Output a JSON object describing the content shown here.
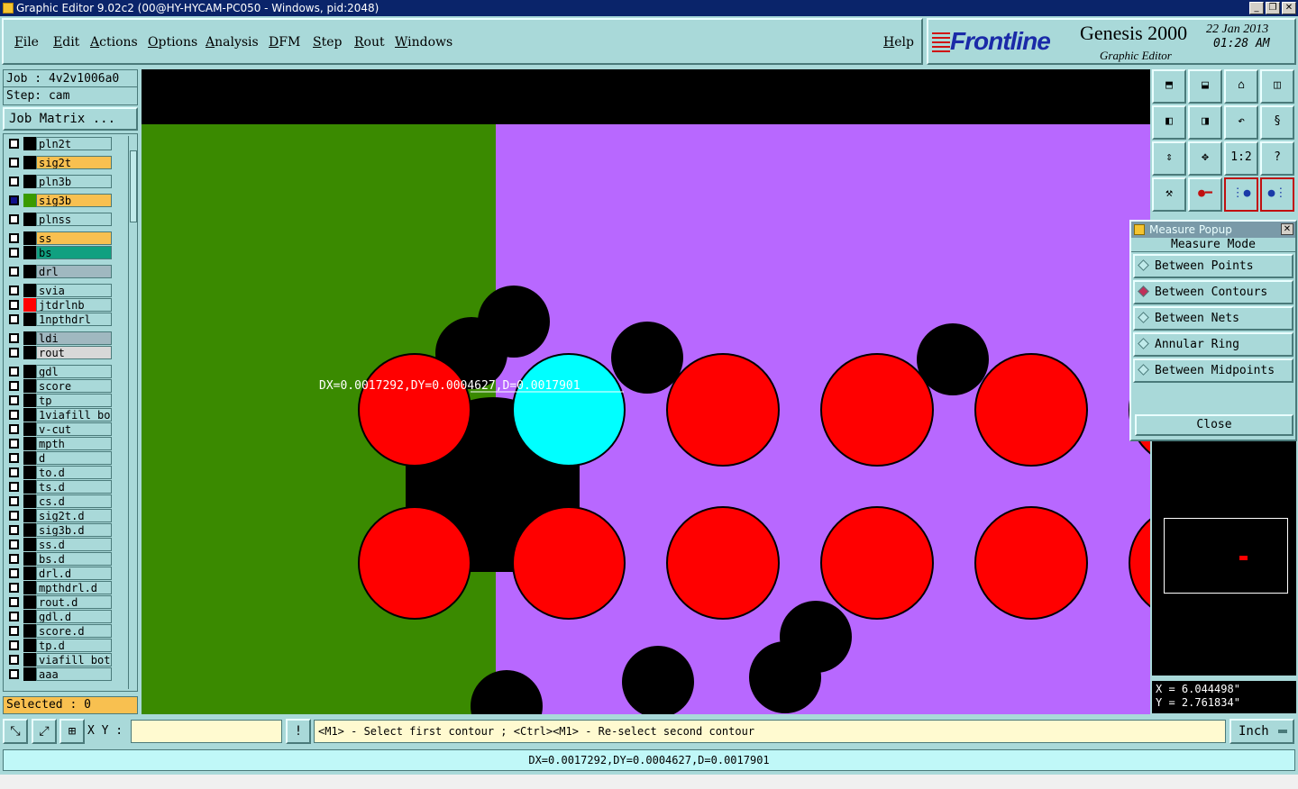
{
  "window": {
    "title": "Graphic Editor 9.02c2 (00@HY-HYCAM-PC050 - Windows, pid:2048)"
  },
  "menu": [
    {
      "label": "File"
    },
    {
      "label": "Edit"
    },
    {
      "label": "Actions"
    },
    {
      "label": "Options"
    },
    {
      "label": "Analysis"
    },
    {
      "label": "DFM"
    },
    {
      "label": "Step"
    },
    {
      "label": "Rout"
    },
    {
      "label": "Windows"
    },
    {
      "label": "Help"
    }
  ],
  "brand": {
    "logo_text": "Frontline",
    "product": "Genesis 2000",
    "subtitle": "Graphic Editor",
    "date": "22 Jan 2013",
    "time": "01:28 AM"
  },
  "job": {
    "job_line": "Job : 4v2v1006a0",
    "step_line": "Step: cam",
    "matrix_button": "Job Matrix ..."
  },
  "layers": [
    {
      "name": "pln2t",
      "color": "#a9d9d9",
      "swatch": "#000000"
    },
    {
      "name": "sig2t",
      "color": "#f8c050",
      "swatch": "#000000"
    },
    {
      "name": "pln3b",
      "color": "#a9d9d9",
      "swatch": "#000000"
    },
    {
      "name": "sig3b",
      "color": "#f8c050",
      "swatch": "#3a9a00",
      "active": true
    },
    {
      "name": "plnss",
      "color": "#a9d9d9",
      "swatch": "#000000"
    },
    {
      "name": "ss",
      "color": "#f8c050",
      "swatch": "#000000"
    },
    {
      "name": "bs",
      "color": "#10a080",
      "swatch": "#000000"
    },
    {
      "name": "drl",
      "color": "#a0b8c0",
      "swatch": "#000000"
    },
    {
      "name": "svia",
      "color": "#a9d9d9",
      "swatch": "#000000"
    },
    {
      "name": "jtdrlnb",
      "color": "#a9d9d9",
      "swatch": "#ff0000"
    },
    {
      "name": "1npthdrl",
      "color": "#a9d9d9",
      "swatch": "#000000"
    },
    {
      "name": "ldi",
      "color": "#a0b8c0",
      "swatch": "#000000"
    },
    {
      "name": "rout",
      "color": "#d8d8d8",
      "swatch": "#000000"
    },
    {
      "name": "gdl",
      "color": "#a9d9d9",
      "swatch": "#000000"
    },
    {
      "name": "score",
      "color": "#a9d9d9",
      "swatch": "#000000"
    },
    {
      "name": "tp",
      "color": "#a9d9d9",
      "swatch": "#000000"
    },
    {
      "name": "1viafill_bot",
      "color": "#a9d9d9",
      "swatch": "#000000"
    },
    {
      "name": "v-cut",
      "color": "#a9d9d9",
      "swatch": "#000000"
    },
    {
      "name": "mpth",
      "color": "#a9d9d9",
      "swatch": "#000000"
    },
    {
      "name": "d",
      "color": "#a9d9d9",
      "swatch": "#000000"
    },
    {
      "name": "to.d",
      "color": "#a9d9d9",
      "swatch": "#000000"
    },
    {
      "name": "ts.d",
      "color": "#a9d9d9",
      "swatch": "#000000"
    },
    {
      "name": "cs.d",
      "color": "#a9d9d9",
      "swatch": "#000000"
    },
    {
      "name": "sig2t.d",
      "color": "#a9d9d9",
      "swatch": "#000000"
    },
    {
      "name": "sig3b.d",
      "color": "#a9d9d9",
      "swatch": "#000000"
    },
    {
      "name": "ss.d",
      "color": "#a9d9d9",
      "swatch": "#000000"
    },
    {
      "name": "bs.d",
      "color": "#a9d9d9",
      "swatch": "#000000"
    },
    {
      "name": "drl.d",
      "color": "#a9d9d9",
      "swatch": "#000000"
    },
    {
      "name": "mpthdrl.d",
      "color": "#a9d9d9",
      "swatch": "#000000"
    },
    {
      "name": "rout.d",
      "color": "#a9d9d9",
      "swatch": "#000000"
    },
    {
      "name": "gdl.d",
      "color": "#a9d9d9",
      "swatch": "#000000"
    },
    {
      "name": "score.d",
      "color": "#a9d9d9",
      "swatch": "#000000"
    },
    {
      "name": "tp.d",
      "color": "#a9d9d9",
      "swatch": "#000000"
    },
    {
      "name": "viafill_bot",
      "color": "#a9d9d9",
      "swatch": "#000000"
    },
    {
      "name": "aaa",
      "color": "#a9d9d9",
      "swatch": "#000000"
    }
  ],
  "selected": "Selected : 0",
  "canvas": {
    "measure_label": "DX=0.0017292,DY=0.0004627,D=0.0017901",
    "colors": {
      "copper": "#ff0000",
      "selected_pad": "#00ffff",
      "region_left": "#3a8a00",
      "region_right": "#b868ff",
      "drill": "#000000"
    }
  },
  "toolbar_icons": [
    "zoom-home-icon",
    "zoom-in-icon",
    "home-icon",
    "window-icon",
    "pan-left-icon",
    "pan-right-icon",
    "undo-icon",
    "redraw-icon",
    "fit-icon",
    "center-icon",
    "ratio-icon",
    "help-icon",
    "tools-icon",
    "measure-icon",
    "netlist-icon",
    "compare-icon"
  ],
  "toolbar_text": {
    "ratio": "1:2",
    "help": "?"
  },
  "measure_popup": {
    "title": "Measure Popup",
    "mode_label": "Measure Mode",
    "options": [
      {
        "label": "Between Points",
        "selected": false
      },
      {
        "label": "Between Contours",
        "selected": true
      },
      {
        "label": "Between Nets",
        "selected": false
      },
      {
        "label": "Annular Ring",
        "selected": false
      },
      {
        "label": "Between Midpoints",
        "selected": false
      }
    ],
    "close_label": "Close"
  },
  "coordinates": {
    "x": "X = 6.044498\"",
    "y": "Y = 2.761834\""
  },
  "bottom": {
    "xy_label": "X Y :",
    "xy_value": "",
    "exclaim": "!",
    "prompt": "<M1> - Select first contour ; <Ctrl><M1> - Re-select second contour",
    "units": "Inch"
  },
  "status": "DX=0.0017292,DY=0.0004627,D=0.0017901"
}
